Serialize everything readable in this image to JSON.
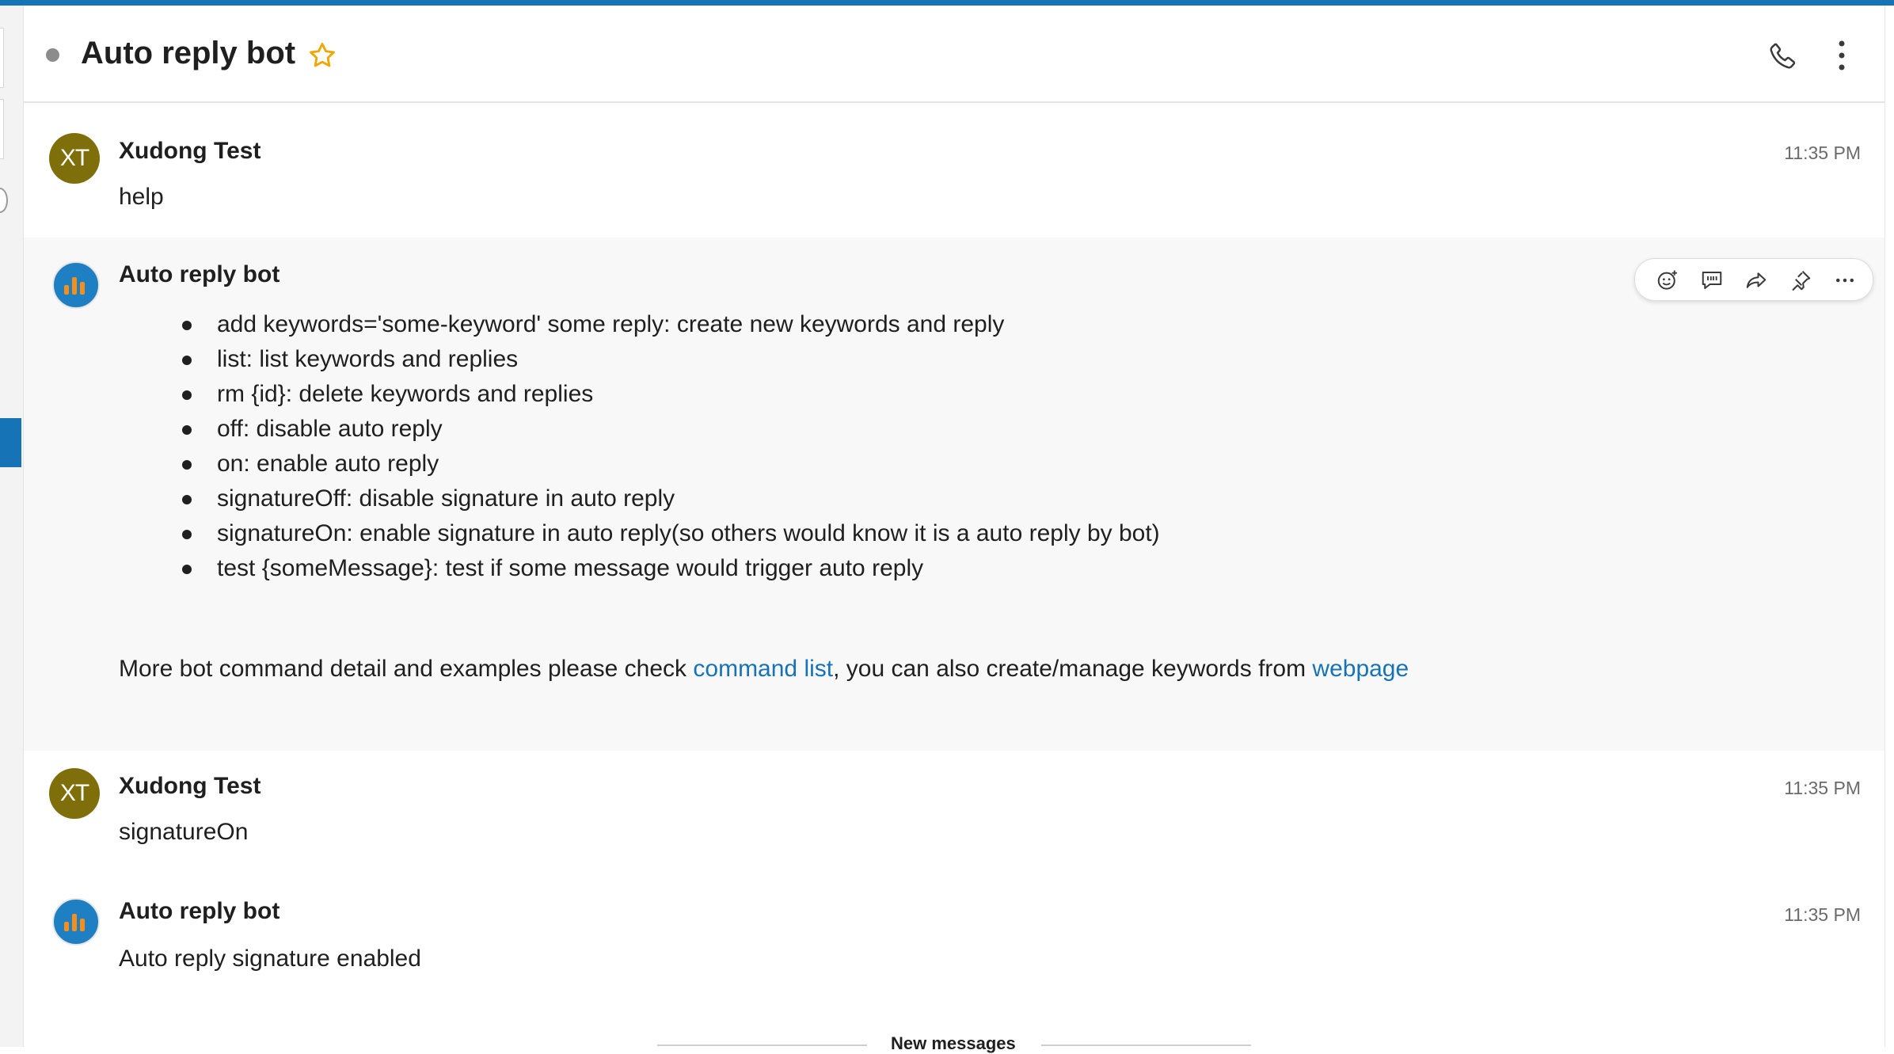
{
  "header": {
    "title": "Auto reply bot",
    "accent_color": "#1673b6",
    "icons": [
      "presence-dot",
      "star-icon",
      "phone-icon",
      "more-vertical-icon"
    ]
  },
  "messages": [
    {
      "sender": "Xudong Test",
      "avatar_initials": "XT",
      "time": "11:35 PM",
      "text": "help"
    },
    {
      "sender": "Auto reply bot",
      "commands": [
        "add keywords='some-keyword' some reply: create new keywords and reply",
        "list: list keywords and replies",
        "rm {id}: delete keywords and replies",
        "off: disable auto reply",
        "on: enable auto reply",
        "signatureOff: disable signature in auto reply",
        "signatureOn: enable signature in auto reply(so others would know it is a auto reply by bot)",
        "test {someMessage}: test if some message would trigger auto reply"
      ],
      "more_prefix": "More bot command detail and examples please check ",
      "link1": "command list",
      "more_middle": ", you can also create/manage keywords from ",
      "link2": "webpage"
    },
    {
      "sender": "Xudong Test",
      "avatar_initials": "XT",
      "time": "11:35 PM",
      "text": "signatureOn"
    },
    {
      "sender": "Auto reply bot",
      "time": "11:35 PM",
      "text": "Auto reply signature enabled"
    }
  ],
  "message_actions": [
    "emoji-reaction-icon",
    "quote-icon",
    "forward-icon",
    "pin-icon",
    "more-horizontal-icon"
  ],
  "divider": {
    "label": "New messages"
  }
}
